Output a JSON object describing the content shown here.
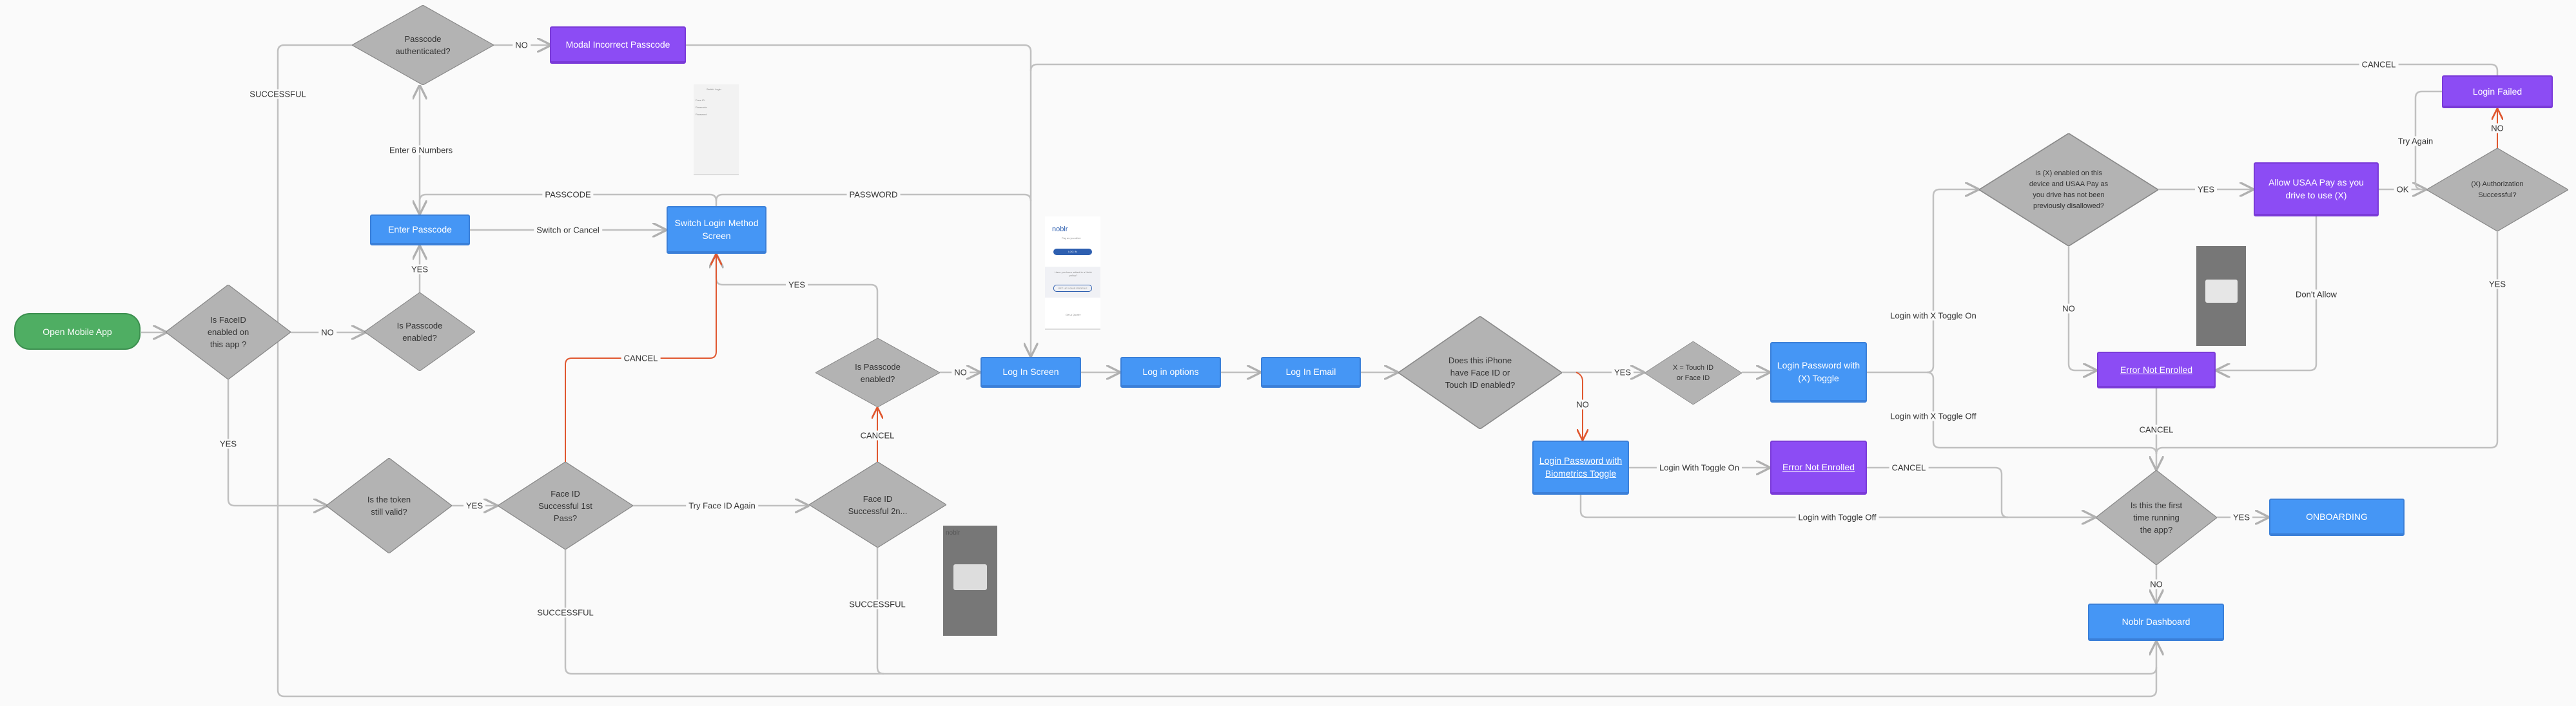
{
  "colors": {
    "background": "#fafafa",
    "process": "#4596f5",
    "error": "#8c4cf4",
    "start": "#4fae63",
    "decision": "#b3b3b3",
    "connector": "#c0c0c0",
    "cancel_path": "#e0572f"
  },
  "nodes": {
    "open_app": "Open Mobile App",
    "faceid_enabled": "Is FaceID\nenabled on\nthis app ?",
    "passcode_enabled_1": "Is Passcode\nenabled?",
    "enter_passcode": "Enter Passcode",
    "passcode_auth": "Passcode\nauthenticated?",
    "modal_incorrect": "Modal Incorrect Passcode",
    "switch_login": "Switch Login Method\nScreen",
    "token_valid": "Is the token\nstill valid?",
    "faceid_1st": "Face ID\nSuccessful 1st\nPass?",
    "faceid_2nd": "Face ID\nSuccessful 2n...",
    "passcode_enabled_2": "Is Passcode\nenabled?",
    "login_screen": "Log In Screen",
    "login_options": "Log in options",
    "login_email": "Log In Email",
    "iphone_biometrics": "Does this iPhone\nhave Face ID or\nTouch ID enabled?",
    "x_touch_face": "X = Touch ID\nor Face ID",
    "login_pw_x_toggle": "Login Password with\n(X) Toggle",
    "login_pw_bio_toggle": "Login Password with\nBiometrics Toggle",
    "error_not_enrolled_1": "Error Not Enrolled",
    "x_enabled": "Is (X) enabled on this\ndevice and USAA Pay as\nyou drive has not been\npreviously disallowed?",
    "allow_usaa": "Allow USAA Pay as you\ndrive to use (X)",
    "x_auth": "(X) Authorization\nSuccessful?",
    "login_failed": "Login Failed",
    "error_not_enrolled_2": "Error Not Enrolled",
    "first_time": "Is this the first\ntime running\nthe app?",
    "onboarding": "ONBOARDING",
    "dashboard": "Noblr Dashboard"
  },
  "edges": {
    "no_faceid": "NO",
    "yes_faceid": "YES",
    "yes_passcode1": "YES",
    "enter_6": "Enter 6 Numbers",
    "successful_left": "SUCCESSFUL",
    "no_auth": "NO",
    "switch_or_cancel": "Switch or Cancel",
    "passcode": "PASSCODE",
    "password": "PASSWORD",
    "yes_token": "YES",
    "try_faceid_again": "Try Face ID Again",
    "cancel_1st": "CANCEL",
    "cancel_2nd": "CANCEL",
    "yes_passcode2": "YES",
    "no_passcode2": "NO",
    "successful_1st": "SUCCESSFUL",
    "successful_2nd": "SUCCESSFUL",
    "yes_bio": "YES",
    "no_bio": "NO",
    "toggle_on_x": "Login with X Toggle On",
    "toggle_off_x": "Login with X Toggle Off",
    "toggle_on_bio": "Login With Toggle On",
    "toggle_off_bio": "Login with Toggle Off",
    "cancel_enroll1": "CANCEL",
    "yes_x": "YES",
    "no_x": "NO",
    "ok": "OK",
    "dont_allow": "Don't Allow",
    "no_auth_x": "NO",
    "yes_auth_x": "YES",
    "try_again": "Try Again",
    "cancel_top": "CANCEL",
    "cancel_enroll2": "CANCEL",
    "yes_first": "YES",
    "no_first": "NO"
  },
  "screenshots": {
    "switch_login": {
      "title": "Switch Login",
      "items": [
        "Face ID",
        "Passcode",
        "Password"
      ]
    },
    "login": {
      "brand": "noblr",
      "tagline": "Pay as you drive",
      "login_button": "LOG IN",
      "question": "Have you been added to a Noblr policy?",
      "setup_button": "SET UP YOUR PROFILE",
      "quote_link": "Get A Quote ›"
    }
  }
}
